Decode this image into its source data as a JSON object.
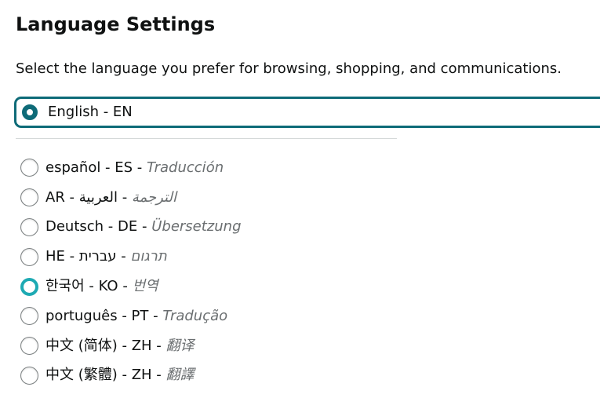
{
  "title": "Language Settings",
  "description": "Select the language you prefer for browsing, shopping, and communications.",
  "selected": {
    "label": "English - EN"
  },
  "options": [
    {
      "code": "es",
      "label": "español - ES",
      "translation": "Traducción",
      "state": "unchecked"
    },
    {
      "code": "ar",
      "label": "العربية - AR",
      "translation": "الترجمة",
      "state": "unchecked"
    },
    {
      "code": "de",
      "label": "Deutsch - DE",
      "translation": "Übersetzung",
      "state": "unchecked"
    },
    {
      "code": "he",
      "label": "עברית - HE",
      "translation": "תרגום",
      "state": "unchecked"
    },
    {
      "code": "ko",
      "label": "한국어 - KO",
      "translation": "번역",
      "state": "focused"
    },
    {
      "code": "pt",
      "label": "português - PT",
      "translation": "Tradução",
      "state": "unchecked"
    },
    {
      "code": "zh-cn",
      "label": "中文 (简体) - ZH",
      "translation": "翻译",
      "state": "unchecked"
    },
    {
      "code": "zh-tw",
      "label": "中文 (繁體) - ZH",
      "translation": "翻譯",
      "state": "unchecked"
    }
  ],
  "colors": {
    "accent": "#0e6b78",
    "focus": "#1eaab3",
    "hint_text": "#6a6e70",
    "divider": "#d5d9d9"
  }
}
